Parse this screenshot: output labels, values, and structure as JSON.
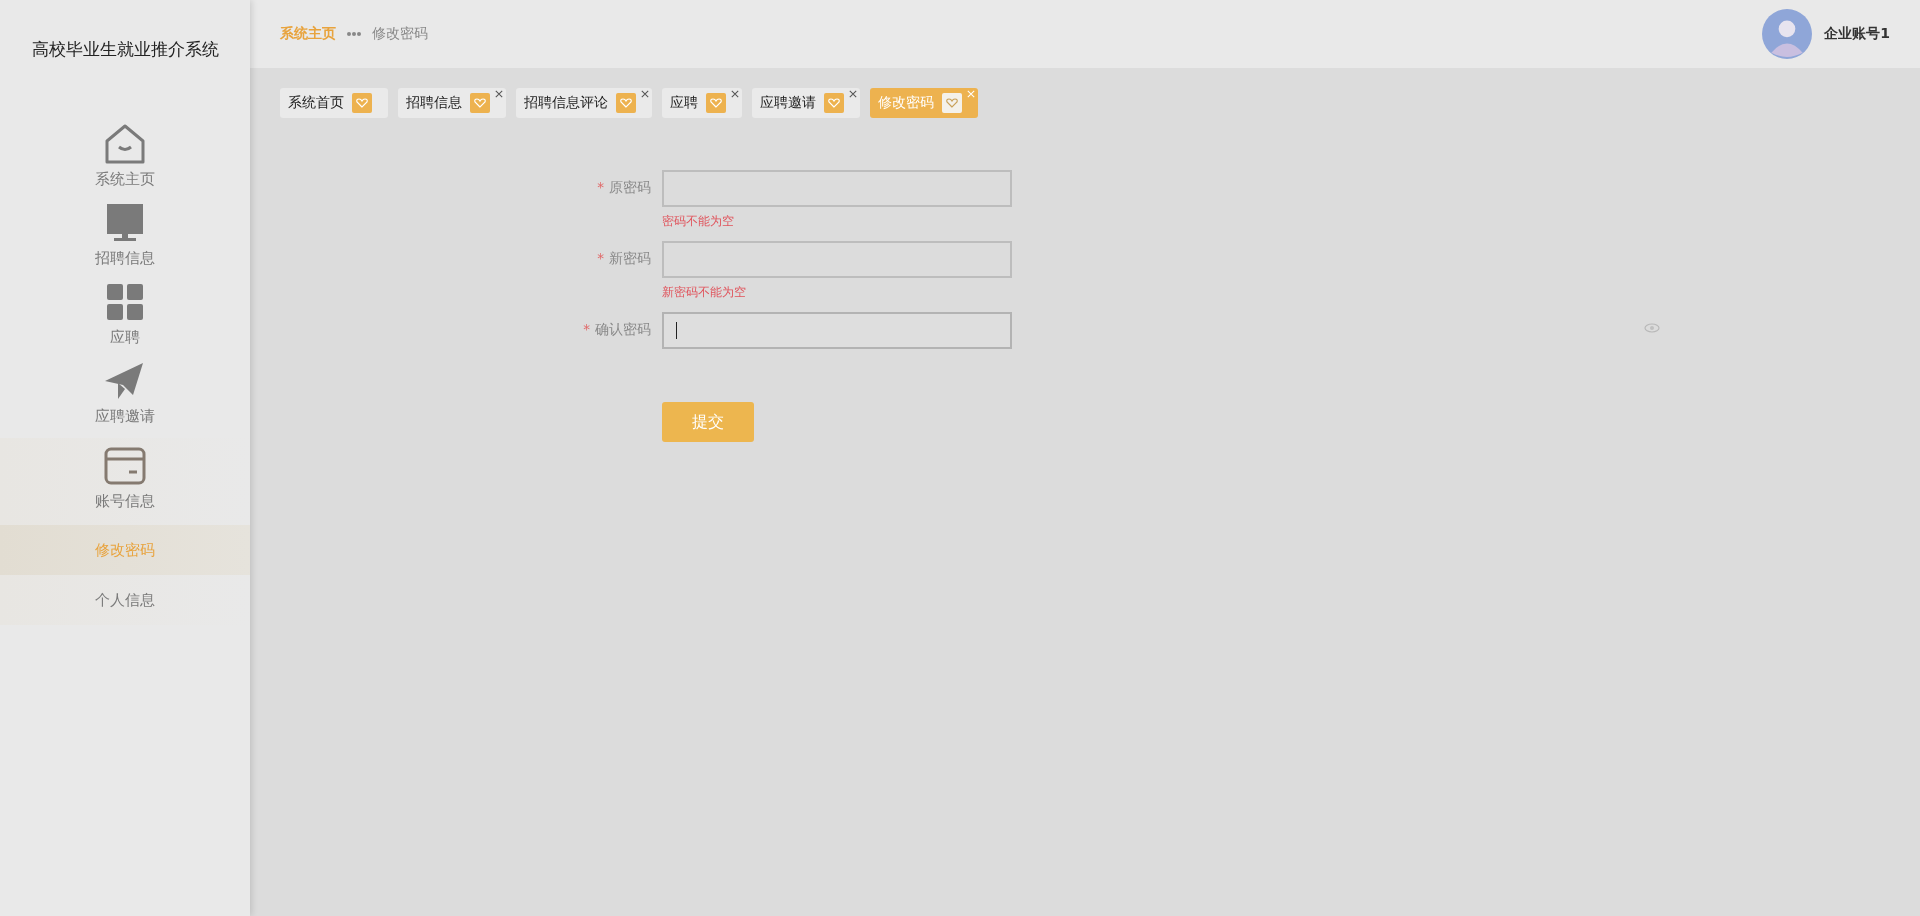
{
  "app_title": "高校毕业生就业推介系统",
  "sidebar": {
    "items": [
      {
        "label": "系统主页",
        "kind": "home",
        "selected": false
      },
      {
        "label": "招聘信息",
        "kind": "monitor",
        "selected": false
      },
      {
        "label": "应聘",
        "kind": "grid",
        "selected": false
      },
      {
        "label": "应聘邀请",
        "kind": "plane",
        "selected": false
      },
      {
        "label": "账号信息",
        "kind": "card",
        "selected": false,
        "children": [
          {
            "label": "修改密码",
            "selected": true
          },
          {
            "label": "个人信息",
            "selected": false
          }
        ]
      }
    ]
  },
  "breadcrumb": [
    {
      "label": "系统主页",
      "kind": "link"
    },
    {
      "label": "修改密码",
      "kind": "current"
    }
  ],
  "user": {
    "name": "企业账号1"
  },
  "tabs": [
    {
      "label": "系统首页",
      "selected": false,
      "closable": false
    },
    {
      "label": "招聘信息",
      "selected": false,
      "closable": true
    },
    {
      "label": "招聘信息评论",
      "selected": false,
      "closable": true
    },
    {
      "label": "应聘",
      "selected": false,
      "closable": true
    },
    {
      "label": "应聘邀请",
      "selected": false,
      "closable": true
    },
    {
      "label": "修改密码",
      "selected": true,
      "closable": true
    }
  ],
  "form": {
    "fields": [
      {
        "label": "原密码",
        "required_mark": "*",
        "error": "密码不能为空"
      },
      {
        "label": "新密码",
        "required_mark": "*",
        "error": "新密码不能为空"
      },
      {
        "label": "确认密码",
        "required_mark": "*",
        "focused": true
      }
    ],
    "submit": "提交"
  }
}
